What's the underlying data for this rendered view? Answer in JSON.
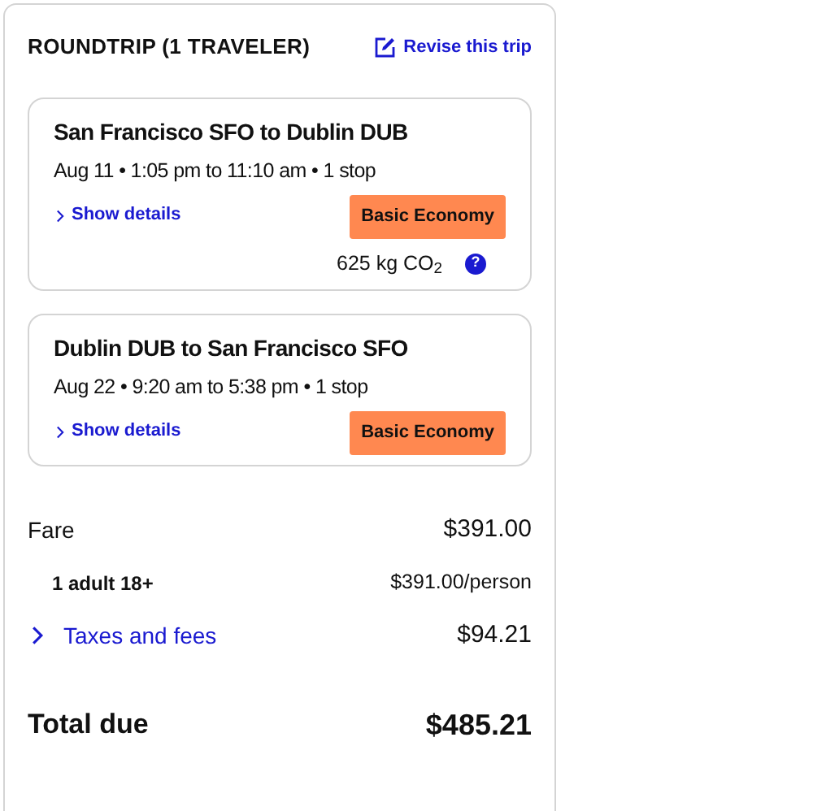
{
  "header": {
    "title": "ROUNDTRIP (1 TRAVELER)",
    "revise_link": "Revise this trip"
  },
  "flights": [
    {
      "route": "San Francisco SFO to Dublin DUB",
      "schedule": "Aug 11 • 1:05 pm to 11:10 am • 1 stop",
      "details_link": "Show details",
      "fare_class": "Basic Economy",
      "emissions": "625 kg CO$_{2}$",
      "emissions_help": "?"
    },
    {
      "route": "Dublin DUB to San Francisco SFO",
      "schedule": "Aug 22 • 9:20 am to 5:38 pm • 1 stop",
      "details_link": "Show details",
      "fare_class": "Basic Economy"
    }
  ],
  "price_lines": [
    {
      "kind": "main",
      "label": "Fare",
      "amount": "$391.00"
    },
    {
      "kind": "sub",
      "label": "1 adult 18+",
      "amount": "$391.00/person"
    },
    {
      "kind": "expandable",
      "label": "Taxes and fees",
      "amount": "$94.21",
      "expanded": false
    }
  ],
  "total": {
    "label": "Total due",
    "amount": "$485.21"
  }
}
